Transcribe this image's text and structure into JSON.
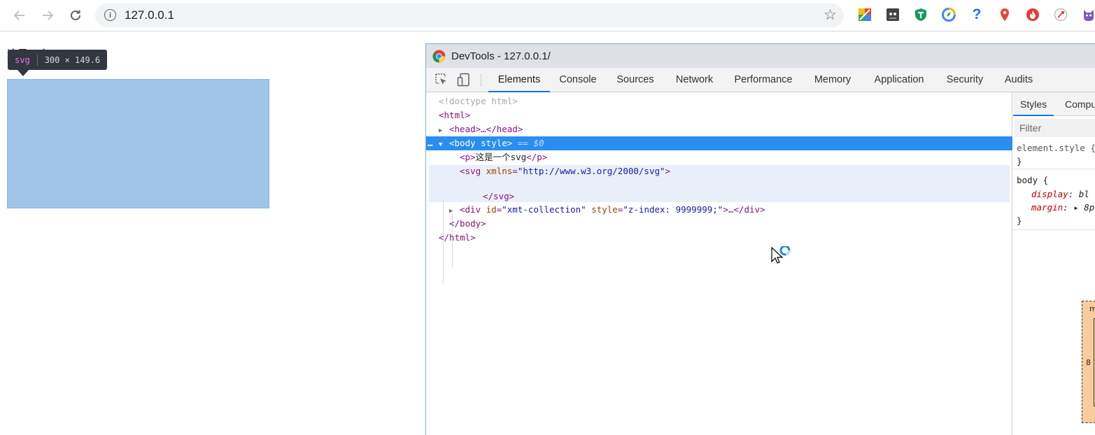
{
  "browser": {
    "url": "127.0.0.1",
    "extensions": [
      {
        "name": "palette-extension-icon",
        "color": "#ea4335"
      },
      {
        "name": "ghost-extension-icon",
        "color": "#5f6368"
      },
      {
        "name": "shield-extension-icon",
        "color": "#0f9d58"
      },
      {
        "name": "compass-extension-icon",
        "color": "#4285f4"
      },
      {
        "name": "help-extension-icon",
        "color": "#1a73e8"
      },
      {
        "name": "map-pin-extension-icon",
        "color": "#ea4335"
      },
      {
        "name": "fire-extension-icon",
        "color": "#e53935"
      },
      {
        "name": "rocket-extension-icon",
        "color": "#9e9e9e"
      },
      {
        "name": "avatar-extension-icon",
        "color": "#7e57c2"
      }
    ]
  },
  "page": {
    "paragraph": "这是一个svg",
    "svg_color": "#a0c4e8"
  },
  "tooltip": {
    "tag": "svg",
    "dimensions": "300 × 149.6"
  },
  "devtools": {
    "title": "DevTools - 127.0.0.1/",
    "tabs": [
      {
        "label": "Elements",
        "active": true
      },
      {
        "label": "Console",
        "active": false
      },
      {
        "label": "Sources",
        "active": false
      },
      {
        "label": "Network",
        "active": false
      },
      {
        "label": "Performance",
        "active": false
      },
      {
        "label": "Memory",
        "active": false
      },
      {
        "label": "Application",
        "active": false
      },
      {
        "label": "Security",
        "active": false
      },
      {
        "label": "Audits",
        "active": false
      }
    ],
    "dom": {
      "doctype": "<!doctype html>",
      "html_open": "<html>",
      "head": "<head>…</head>",
      "body_open": "<body style>",
      "body_eq": " == $0",
      "p_open": "<p>",
      "p_text": "这是一个svg",
      "p_close": "</p>",
      "svg_tag": "<svg ",
      "svg_attr": "xmlns",
      "svg_val": "\"http://www.w3.org/2000/svg\"",
      "svg_end": ">",
      "svg_close": "</svg>",
      "div_tag": "<div ",
      "div_attr1": "id",
      "div_val1": "\"xmt-collection\"",
      "div_attr2": " style",
      "div_val2": "\"z-index: 9999999;\"",
      "div_end": ">…</div>",
      "body_close": "</body>",
      "html_close": "</html>",
      "ellipsis": "…"
    },
    "styles": {
      "tabs": [
        "Styles",
        "Compu"
      ],
      "filter_placeholder": "Filter",
      "element_style": "element.style {",
      "close_brace": "}",
      "body_selector": "body {",
      "prop1": "display",
      "val1": ": bl",
      "prop2": "margin",
      "val2": ": ▸ 8p",
      "box_value": "8",
      "box_label": "m"
    }
  }
}
